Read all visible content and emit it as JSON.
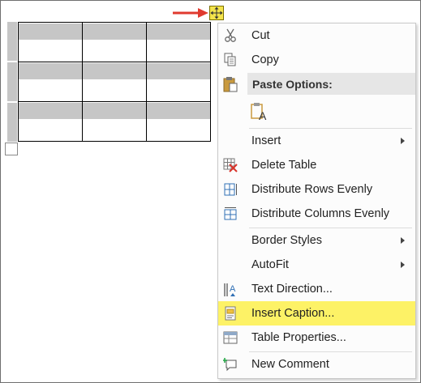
{
  "menu": {
    "cut": "Cut",
    "copy": "Copy",
    "paste_options": "Paste Options:",
    "insert": "Insert",
    "delete_table": "Delete Table",
    "distribute_rows": "Distribute Rows Evenly",
    "distribute_columns": "Distribute Columns Evenly",
    "border_styles": "Border Styles",
    "autofit": "AutoFit",
    "text_direction": "Text Direction...",
    "insert_caption": "Insert Caption...",
    "table_properties": "Table Properties...",
    "new_comment": "New Comment"
  },
  "icons": {
    "cut": "scissors-icon",
    "copy": "copy-icon",
    "paste": "clipboard-icon",
    "paste_keep_text": "paste-keep-text-only-icon",
    "delete_table": "delete-table-icon",
    "distribute_rows": "distribute-rows-icon",
    "distribute_columns": "distribute-columns-icon",
    "text_direction": "text-direction-icon",
    "insert_caption": "insert-caption-icon",
    "table_properties": "table-properties-icon",
    "new_comment": "new-comment-icon",
    "move_handle": "table-move-handle-icon",
    "arrow": "red-arrow-annotation"
  },
  "colors": {
    "highlight": "#fdf266",
    "header_fill": "#e6e6e6",
    "row_selection": "#c6c6c6",
    "arrow": "#e03a2f"
  }
}
